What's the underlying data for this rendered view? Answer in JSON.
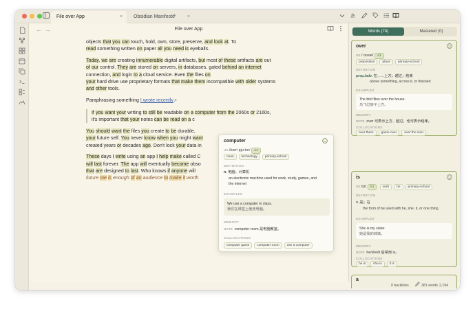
{
  "tabs": [
    {
      "label": "File over App"
    },
    {
      "label": "Obsidian Manifesto"
    }
  ],
  "tab_close": "×",
  "new_tab": "+",
  "view_title": "File over App",
  "nav": {
    "back": "←",
    "forward": "→"
  },
  "content": {
    "line0a": "objects ",
    "line0b": "that",
    "line0c": " ",
    "line0d": "you",
    "line0e": " ",
    "line0f": "can",
    "line0g": " touch, hold, own, store, preserve, ",
    "line0h": "and",
    "line0i": " ",
    "line0j": "look",
    "line0k": " ",
    "line0l": "at",
    "line0m": ". To",
    "line1a": "read",
    "line1b": " something written ",
    "line1c": "on",
    "line1d": " paper ",
    "line1e": "all",
    "line1f": " ",
    "line1g": "you",
    "line1h": " ",
    "line1i": "need",
    "line1j": " ",
    "line1k": "is",
    "line1l": " eyeballs.",
    "p2": [
      [
        "Today",
        true
      ],
      [
        ", ",
        false
      ],
      [
        "we",
        true
      ],
      [
        " ",
        false
      ],
      [
        "are",
        true
      ],
      [
        " creating ",
        false
      ],
      [
        "innumerable",
        true
      ],
      [
        " digital artifacts, ",
        false
      ],
      [
        "but",
        true
      ],
      [
        " most ",
        false
      ],
      [
        "of",
        true
      ],
      [
        " ",
        false
      ],
      [
        "these",
        true
      ],
      [
        " artifacts ",
        false
      ],
      [
        "are",
        true
      ],
      [
        " out",
        false
      ]
    ],
    "p2b": [
      [
        "of",
        true
      ],
      [
        " ",
        false
      ],
      [
        "our",
        true
      ],
      [
        " control. ",
        false
      ],
      [
        "They",
        true
      ],
      [
        " ",
        false
      ],
      [
        "are",
        true
      ],
      [
        " stored ",
        false
      ],
      [
        "on",
        true
      ],
      [
        " servers, ",
        false
      ],
      [
        "in",
        true
      ],
      [
        " databases, gated ",
        false
      ],
      [
        "behind",
        true
      ],
      [
        " ",
        false
      ],
      [
        "an",
        true
      ],
      [
        " ",
        false
      ],
      [
        "internet",
        true
      ]
    ],
    "p2c": [
      [
        "connection, ",
        false
      ],
      [
        "and",
        true
      ],
      [
        " login ",
        false
      ],
      [
        "to",
        true
      ],
      [
        " ",
        false
      ],
      [
        "a",
        true
      ],
      [
        " cloud service. Even ",
        false
      ],
      [
        "the",
        true
      ],
      [
        " files ",
        false
      ],
      [
        "on",
        true
      ]
    ],
    "p2d": [
      [
        "your",
        true
      ],
      [
        " hard drive use proprietary formats ",
        false
      ],
      [
        "that",
        true
      ],
      [
        " ",
        false
      ],
      [
        "make",
        true
      ],
      [
        " ",
        false
      ],
      [
        "them",
        true
      ],
      [
        " incompatible ",
        false
      ],
      [
        "with",
        true
      ],
      [
        " ",
        false
      ],
      [
        "older",
        true
      ],
      [
        " systems",
        false
      ]
    ],
    "p2e": [
      [
        "and",
        true
      ],
      [
        " ",
        false
      ],
      [
        "other",
        true
      ],
      [
        " tools.",
        false
      ]
    ],
    "p3_text": "Paraphrasing something ",
    "p3_link": "I wrote recently",
    "p3_ext": "↗",
    "q1": [
      [
        "If",
        true
      ],
      [
        " ",
        false
      ],
      [
        "you",
        true
      ],
      [
        " ",
        false
      ],
      [
        "want",
        true
      ],
      [
        " ",
        false
      ],
      [
        "your",
        true
      ],
      [
        " writing ",
        false
      ],
      [
        "to",
        true
      ],
      [
        " ",
        false
      ],
      [
        "still",
        true
      ],
      [
        " ",
        false
      ],
      [
        "be",
        true
      ],
      [
        " readable ",
        false
      ],
      [
        "on",
        true
      ],
      [
        " ",
        false
      ],
      [
        "a",
        true
      ],
      [
        " ",
        false
      ],
      [
        "computer",
        true
      ],
      [
        " ",
        false
      ],
      [
        "from",
        true
      ],
      [
        " ",
        false
      ],
      [
        "the",
        true
      ],
      [
        " 2060s ",
        false
      ],
      [
        "or",
        true
      ],
      [
        " 2160s,",
        false
      ]
    ],
    "q2": [
      [
        "it's important ",
        false
      ],
      [
        "that",
        true
      ],
      [
        " ",
        false
      ],
      [
        "your",
        true
      ],
      [
        " notes ",
        false
      ],
      [
        "can",
        true
      ],
      [
        " ",
        false
      ],
      [
        "be",
        true
      ],
      [
        " ",
        false
      ],
      [
        "read",
        true
      ],
      [
        " ",
        false
      ],
      [
        "on",
        true
      ],
      [
        " ",
        false
      ],
      [
        "a",
        true
      ],
      [
        " c",
        false
      ]
    ],
    "p4a": [
      [
        "You",
        true
      ],
      [
        " ",
        false
      ],
      [
        "should",
        true
      ],
      [
        " ",
        false
      ],
      [
        "want",
        true
      ],
      [
        " ",
        false
      ],
      [
        "the",
        true
      ],
      [
        " files ",
        false
      ],
      [
        "you",
        true
      ],
      [
        " create ",
        false
      ],
      [
        "to",
        true
      ],
      [
        " ",
        false
      ],
      [
        "be",
        true
      ],
      [
        " durable, ",
        false
      ]
    ],
    "p4b": [
      [
        "your",
        true
      ],
      [
        " future self. ",
        false
      ],
      [
        "You",
        true
      ],
      [
        " never ",
        false
      ],
      [
        "know",
        true
      ],
      [
        " ",
        false
      ],
      [
        "when",
        true
      ],
      [
        " ",
        false
      ],
      [
        "you",
        true
      ],
      [
        " might ",
        false
      ],
      [
        "want",
        true
      ]
    ],
    "p4c": [
      [
        "created years ",
        false
      ],
      [
        "or",
        true
      ],
      [
        " decades ",
        false
      ],
      [
        "ago",
        true
      ],
      [
        ". Don't lock ",
        false
      ],
      [
        "your",
        true
      ],
      [
        " data in",
        false
      ]
    ],
    "p5a": [
      [
        "These",
        true
      ],
      [
        " days ",
        false
      ],
      [
        "I",
        true
      ],
      [
        " ",
        false
      ],
      [
        "write",
        true
      ],
      [
        " using ",
        false
      ],
      [
        "an",
        true
      ],
      [
        " app ",
        false
      ],
      [
        "I",
        true
      ],
      [
        " ",
        false
      ],
      [
        "help",
        true
      ],
      [
        " ",
        false
      ],
      [
        "make",
        true
      ],
      [
        " called C",
        false
      ]
    ],
    "p5b": [
      [
        "will",
        true
      ],
      [
        " ",
        false
      ],
      [
        "last",
        true
      ],
      [
        " forever. ",
        false
      ],
      [
        "The",
        true
      ],
      [
        " app ",
        false
      ],
      [
        "will",
        true
      ],
      [
        " eventually ",
        false
      ],
      [
        "become",
        true
      ],
      [
        " obso",
        false
      ]
    ],
    "p5c": [
      [
        "that",
        true
      ],
      [
        " ",
        false
      ],
      [
        "are",
        true
      ],
      [
        " designed ",
        false
      ],
      [
        "to",
        true
      ],
      [
        " ",
        false
      ],
      [
        "last",
        true
      ],
      [
        ". Who knows ",
        false
      ],
      [
        "if",
        true
      ],
      [
        " ",
        false
      ],
      [
        "anyone",
        true
      ],
      [
        " will ",
        false
      ]
    ],
    "p5d": [
      [
        "future ",
        false
      ],
      [
        "me",
        true
      ],
      [
        " ",
        false
      ],
      [
        "is",
        true
      ],
      [
        " enough ",
        false
      ],
      [
        "of",
        true
      ],
      [
        " ",
        false
      ],
      [
        "an",
        true
      ],
      [
        " audience ",
        false
      ],
      [
        "to",
        true
      ],
      [
        " ",
        false
      ],
      [
        "make",
        true
      ],
      [
        " ",
        false
      ],
      [
        "it",
        true
      ],
      [
        " worth",
        false
      ]
    ]
  },
  "popup": {
    "word": "computer",
    "phonetic": "/kəmˈpjuːtər/",
    "level": "A1",
    "tags": [
      "noun",
      "technology",
      "primary-school"
    ],
    "definition_label": "DEFINITION",
    "pos": "n.",
    "zh": "电脑；计算机",
    "en_def": "an electronic machine used for work, study, games, and",
    "en_def2": "the internet",
    "examples_label": "EXAMPLES",
    "example_en": "We use a computer in class.",
    "example_zh": "我们在课堂上使用电脑。",
    "memory_label": "MEMORY",
    "note_label": "NOTE",
    "note": "computer room 是电脑教室。",
    "collocations_label": "COLLOCATIONS",
    "collocations": [
      "computer game",
      "computer room",
      "use a computer"
    ]
  },
  "right_panel": {
    "tab_words": "Words (74)",
    "tab_mastered": "Mastered (0)",
    "card1": {
      "word": "over",
      "phonetic": "/ˈoʊvər/",
      "level": "A1",
      "tags": [
        "preposition",
        "place",
        "primary-school"
      ],
      "definition_label": "DEFINITION",
      "pos": "prep./adv.",
      "zh": "在……上方；越过；结束",
      "en_def": "above something, across it, or finished",
      "examples_label": "EXAMPLES",
      "example_en": "The bird flies over the house.",
      "example_zh": "鸟飞过房子上方。",
      "memory_label": "MEMORY",
      "note_label": "NOTE",
      "note": "over 可表示上方、越过，也可表示结束。",
      "collocations_label": "COLLOCATIONS",
      "collocations": [
        "over there",
        "game over",
        "over the river"
      ]
    },
    "card2": {
      "word": "is",
      "phonetic": "/ɪz/",
      "level": "A1",
      "tags": [
        "verb",
        "be",
        "primary-school"
      ],
      "definition_label": "DEFINITION",
      "pos": "v.",
      "zh": "是；在",
      "en_def": "the form of be used with he, she, it, or one thing",
      "examples_label": "EXAMPLES",
      "example_en": "She is my sister.",
      "example_zh": "她是我的妹妹。",
      "memory_label": "MEMORY",
      "note_label": "NOTE",
      "note": "he/she/it 后常用 is。",
      "collocations_label": "COLLOCATIONS",
      "collocations": [
        "he is",
        "she is",
        "it is"
      ]
    },
    "card3_word": "a"
  },
  "status": {
    "backlinks": "0 backlinks",
    "words": "381 words",
    "characters": "2,194 characters"
  },
  "colors": {
    "accent": "#3f6e5c",
    "highlight": "#e3e4bb",
    "card_border": "#9aab66"
  }
}
